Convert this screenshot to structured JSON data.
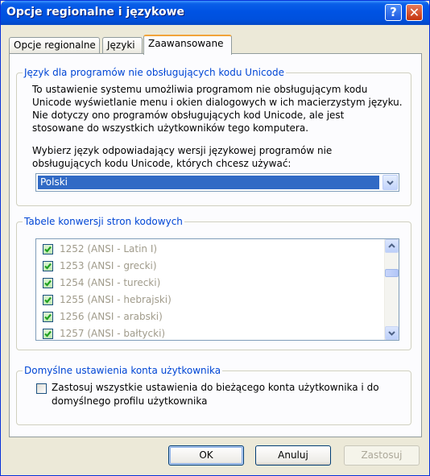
{
  "window": {
    "title": "Opcje regionalne i językowe"
  },
  "titlebar_buttons": {
    "help": "?",
    "close": "✕"
  },
  "tabs": [
    {
      "label": "Opcje regionalne",
      "active": false
    },
    {
      "label": "Języki",
      "active": false
    },
    {
      "label": "Zaawansowane",
      "active": true
    }
  ],
  "unicode_group": {
    "title": "Język dla programów nie obsługujących kodu Unicode",
    "description_lines": [
      "To ustawienie systemu umożliwia programom nie obsługującym kodu",
      "Unicode wyświetlanie menu i okien dialogowych w ich macierzystym języku.",
      "Nie dotyczy ono programów obsługujących kod Unicode, ale jest",
      "stosowane do wszystkich użytkowników tego komputera."
    ],
    "prompt_lines": [
      "Wybierz język odpowiadający wersji językowej programów nie",
      "obsługujących kodu Unicode, których chcesz używać:"
    ],
    "selected_language": "Polski"
  },
  "codepage_group": {
    "title": "Tabele konwersji stron kodowych",
    "items": [
      {
        "label": "1252  (ANSI - Latin I)",
        "checked": true
      },
      {
        "label": "1253  (ANSI - grecki)",
        "checked": true
      },
      {
        "label": "1254  (ANSI - turecki)",
        "checked": true
      },
      {
        "label": "1255  (ANSI - hebrajski)",
        "checked": true
      },
      {
        "label": "1256  (ANSI - arabski)",
        "checked": true
      },
      {
        "label": "1257  (ANSI - bałtycki)",
        "checked": true
      }
    ]
  },
  "default_user_group": {
    "title": "Domyślne ustawienia konta użytkownika",
    "checkbox_label": "Zastosuj wszystkie ustawienia do bieżącego konta użytkownika i do domyślnego profilu użytkownika",
    "checked": false
  },
  "buttons": {
    "ok": "OK",
    "cancel": "Anuluj",
    "apply": "Zastosuj"
  },
  "colors": {
    "accent": "#0046d5",
    "title_bar": "#0053e3",
    "selection": "#316ac5",
    "check_green": "#21a121"
  }
}
